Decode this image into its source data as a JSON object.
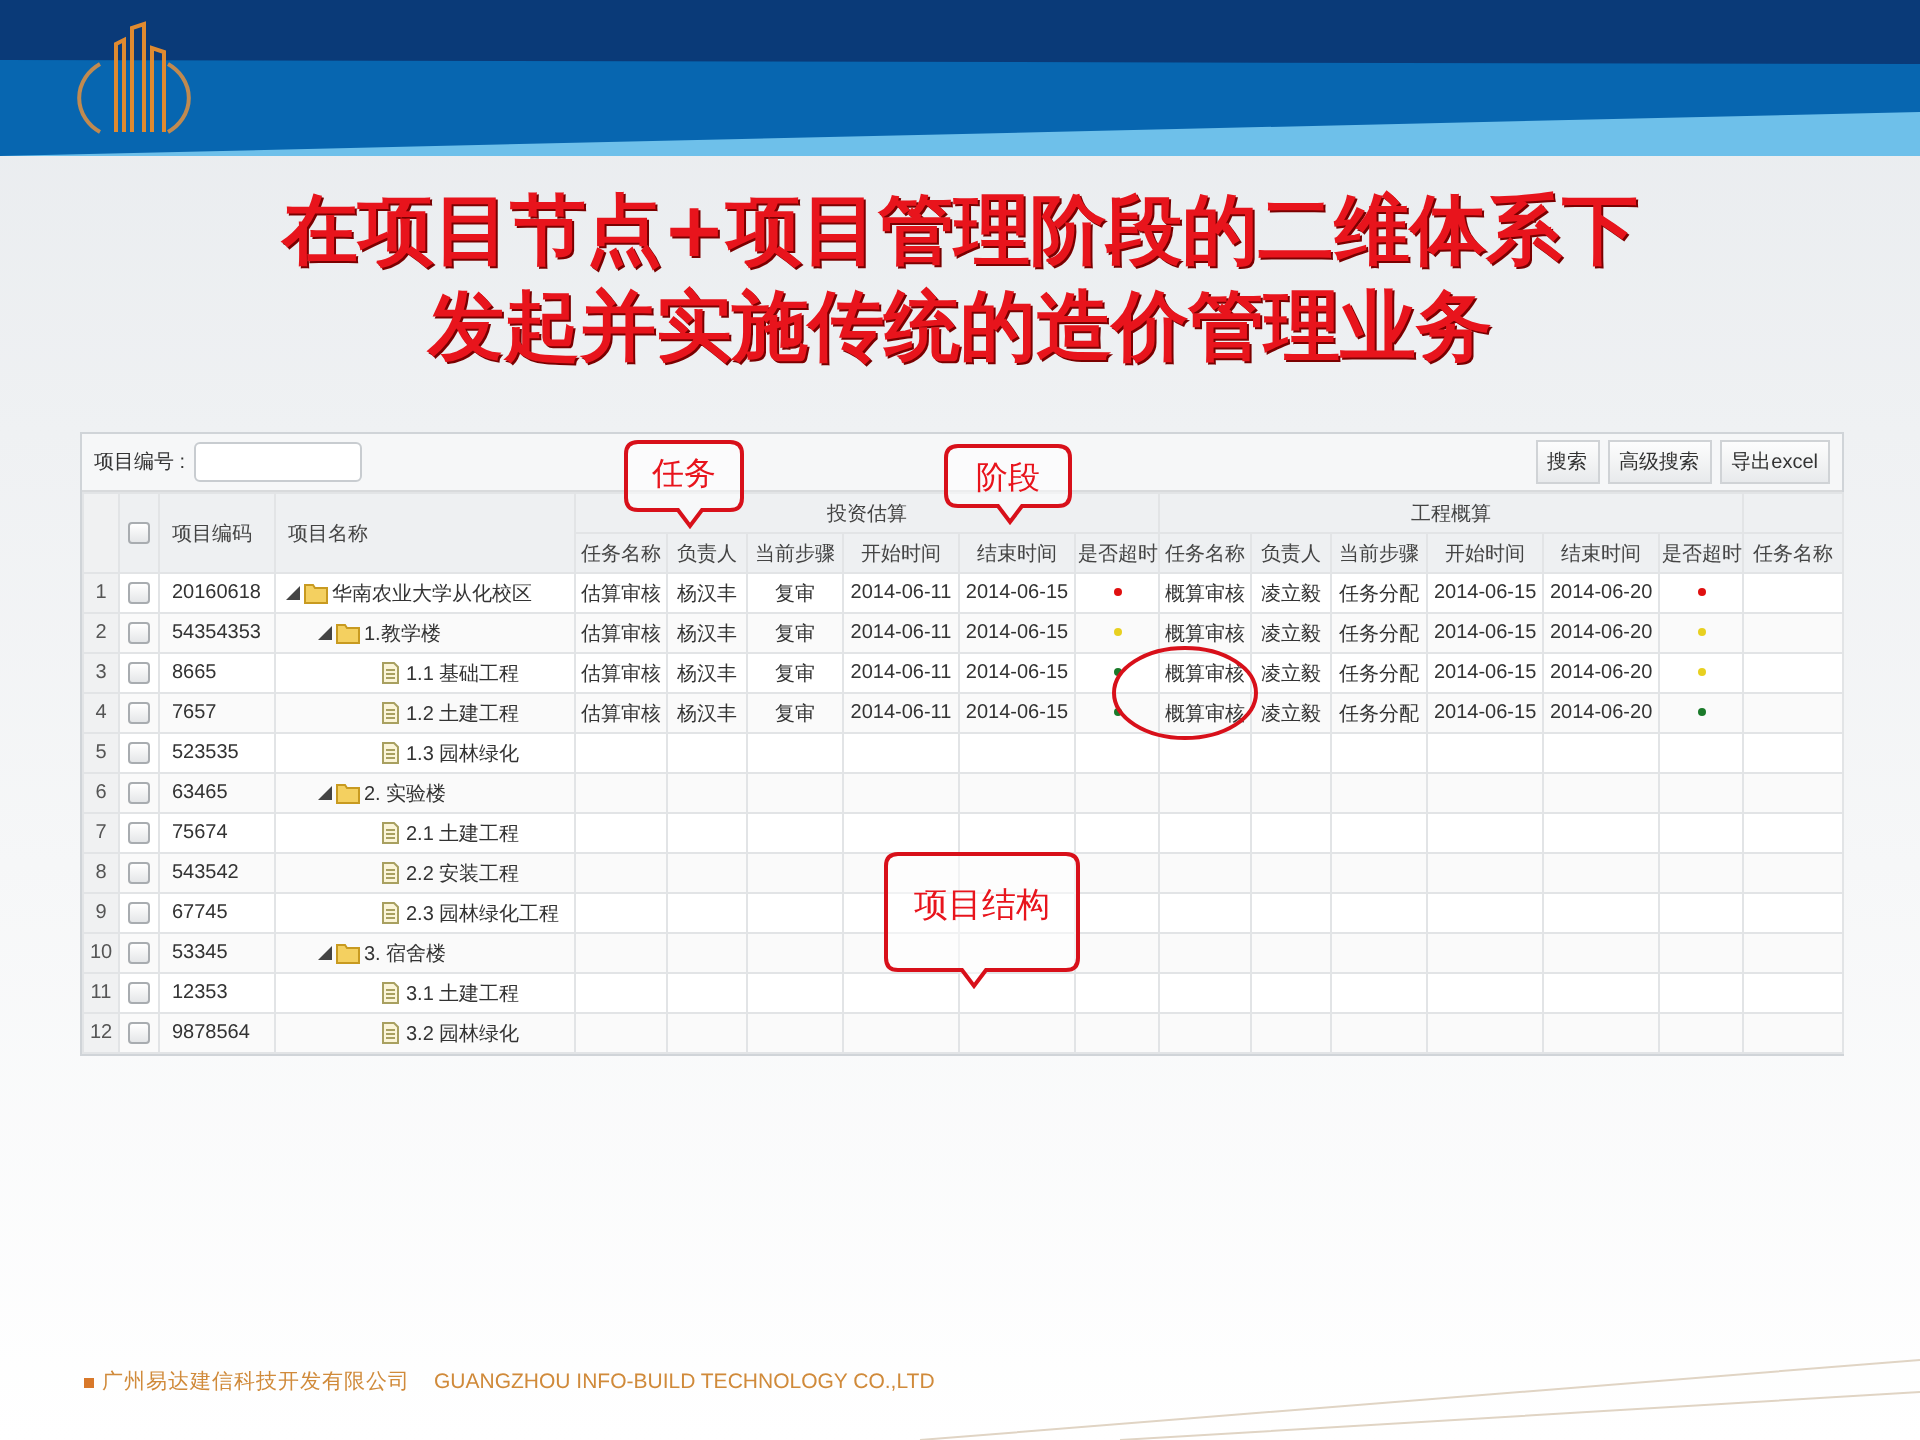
{
  "title_lines": [
    "在项目节点+项目管理阶段的二维体系下",
    "发起并实施传统的造价管理业务"
  ],
  "toolbar": {
    "label": "项目编号 :",
    "buttons": [
      "搜索",
      "高级搜索",
      "导出excel"
    ]
  },
  "table": {
    "select_all": {
      "checked": false
    },
    "columns": [
      "项目编码",
      "项目名称"
    ],
    "groups": [
      {
        "title": "投资估算",
        "columns": [
          "任务名称",
          "负责人",
          "当前步骤",
          "开始时间",
          "结束时间",
          "是否超时"
        ]
      },
      {
        "title": "工程概算",
        "columns": [
          "任务名称",
          "负责人",
          "当前步骤",
          "开始时间",
          "结束时间",
          "是否超时"
        ]
      }
    ],
    "extra_column": "任务名称",
    "rows": [
      {
        "number": "1",
        "checked": false,
        "code": "20160618",
        "label": "华南农业大学从化校区",
        "kind": "folder",
        "expanded": true,
        "stages": [
          {
            "task": "估算审核",
            "owner": "杨汉丰",
            "step": "复审",
            "start": "2014-06-11",
            "end": "2014-06-15",
            "color": "#e01010"
          },
          {
            "task": "概算审核",
            "owner": "凌立毅",
            "step": "任务分配",
            "start": "2014-06-15",
            "end": "2014-06-20",
            "color": "#e01010"
          }
        ],
        "children": [
          {
            "number": "2",
            "checked": false,
            "code": "54354353",
            "label": "1.教学楼",
            "kind": "folder",
            "expanded": true,
            "stages": [
              {
                "task": "估算审核",
                "owner": "杨汉丰",
                "step": "复审",
                "start": "2014-06-11",
                "end": "2014-06-15",
                "color": "#e8d020"
              },
              {
                "task": "概算审核",
                "owner": "凌立毅",
                "step": "任务分配",
                "start": "2014-06-15",
                "end": "2014-06-20",
                "color": "#e8d020"
              }
            ],
            "children": [
              {
                "number": "3",
                "checked": false,
                "code": "8665",
                "label": "1.1 基础工程",
                "kind": "file",
                "stages": [
                  {
                    "task": "估算审核",
                    "owner": "杨汉丰",
                    "step": "复审",
                    "start": "2014-06-11",
                    "end": "2014-06-15",
                    "color": "#1a7a2a"
                  },
                  {
                    "task": "概算审核",
                    "owner": "凌立毅",
                    "step": "任务分配",
                    "start": "2014-06-15",
                    "end": "2014-06-20",
                    "color": "#e8d020"
                  }
                ]
              },
              {
                "number": "4",
                "checked": false,
                "code": "7657",
                "label": "1.2 土建工程",
                "kind": "file",
                "stages": [
                  {
                    "task": "估算审核",
                    "owner": "杨汉丰",
                    "step": "复审",
                    "start": "2014-06-11",
                    "end": "2014-06-15",
                    "color": "#1a7a2a"
                  },
                  {
                    "task": "概算审核",
                    "owner": "凌立毅",
                    "step": "任务分配",
                    "start": "2014-06-15",
                    "end": "2014-06-20",
                    "color": "#1a7a2a"
                  }
                ]
              },
              {
                "number": "5",
                "checked": false,
                "code": "523535",
                "label": "1.3 园林绿化",
                "kind": "file"
              }
            ]
          },
          {
            "number": "6",
            "checked": false,
            "code": "63465",
            "label": "2. 实验楼",
            "kind": "folder",
            "expanded": true,
            "children": [
              {
                "number": "7",
                "checked": false,
                "code": "75674",
                "label": "2.1 土建工程",
                "kind": "file"
              },
              {
                "number": "8",
                "checked": false,
                "code": "543542",
                "label": "2.2 安装工程",
                "kind": "file"
              },
              {
                "number": "9",
                "checked": false,
                "code": "67745",
                "label": "2.3 园林绿化工程",
                "kind": "file"
              }
            ]
          },
          {
            "number": "10",
            "checked": false,
            "code": "53345",
            "label": "3. 宿舍楼",
            "kind": "folder",
            "expanded": true,
            "children": [
              {
                "number": "11",
                "checked": false,
                "code": "12353",
                "label": "3.1 土建工程",
                "kind": "file"
              },
              {
                "number": "12",
                "checked": false,
                "code": "9878564",
                "label": "3.2 园林绿化",
                "kind": "file"
              }
            ]
          }
        ]
      }
    ]
  },
  "callouts": [
    {
      "text": "任务"
    },
    {
      "text": "阶段"
    },
    {
      "text": "项目结构"
    }
  ],
  "footer": {
    "company_cn": "广州易达建信科技开发有限公司",
    "company_en": "GUANGZHOU INFO-BUILD TECHNOLOGY CO.,LTD"
  }
}
